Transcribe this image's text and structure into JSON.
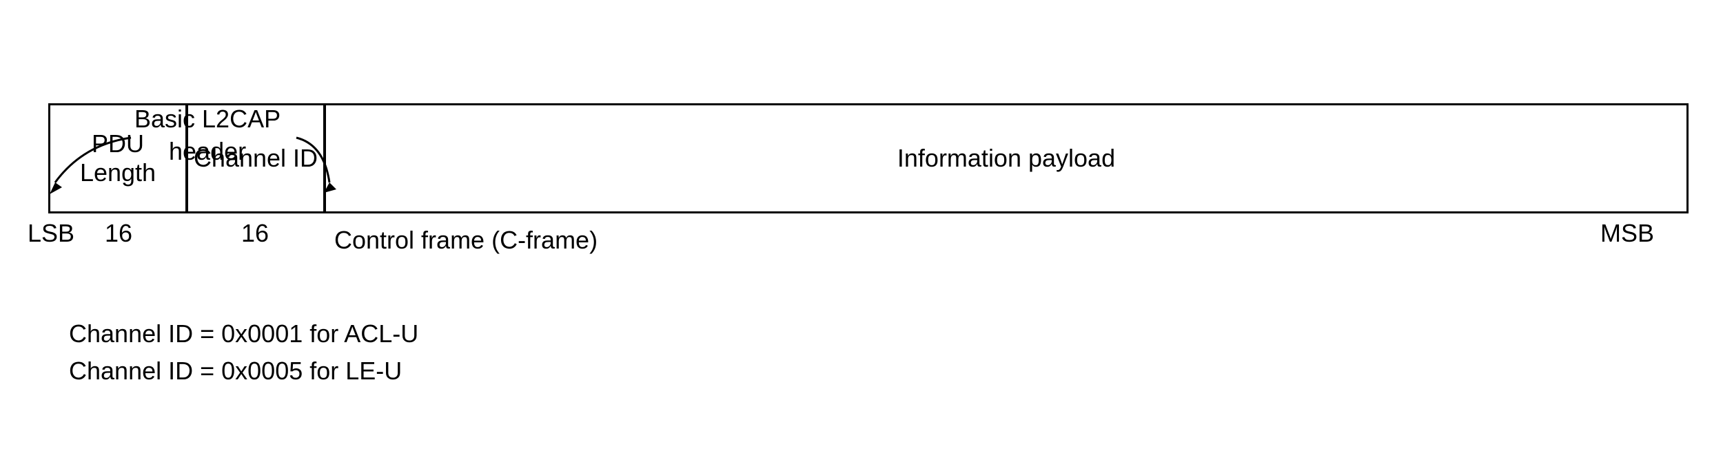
{
  "header": {
    "label_line1": "Basic L2CAP",
    "label_line2": "header"
  },
  "frame": {
    "fields": [
      {
        "name": "PDU Length",
        "bits": "16"
      },
      {
        "name": "Channel ID",
        "bits": "16"
      },
      {
        "name": "Information payload",
        "bits": ""
      }
    ],
    "lsb": "LSB",
    "msb": "MSB",
    "caption": "Control frame (C-frame)"
  },
  "notes": {
    "line1": "Channel ID = 0x0001 for ACL-U",
    "line2": "Channel ID = 0x0005 for LE-U"
  }
}
